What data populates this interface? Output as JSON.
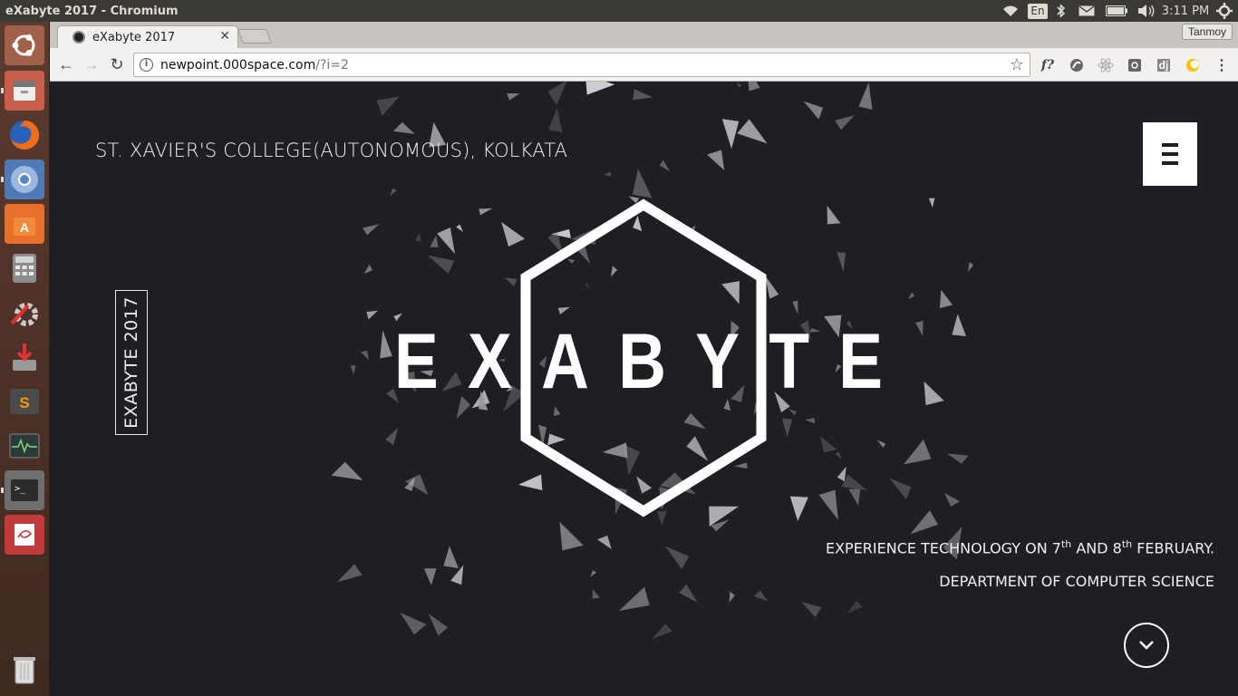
{
  "panel": {
    "window_title": "eXabyte 2017 - Chromium",
    "keyboard_layout": "En",
    "clock": "3:11 PM",
    "icons": [
      "wifi-icon",
      "bluetooth-icon",
      "mail-icon",
      "battery-icon",
      "volume-icon",
      "power-gear-icon"
    ]
  },
  "launcher": {
    "items": [
      "ubuntu-dash",
      "files",
      "firefox",
      "chromium",
      "software-center",
      "calculator",
      "system-settings",
      "installer",
      "sublime-text",
      "system-monitor",
      "terminal",
      "document-viewer",
      "trash"
    ]
  },
  "browser": {
    "tab_title": "eXabyte 2017",
    "profile_name": "Tanmoy",
    "url_host": "newpoint.000space.com",
    "url_path": "/?i=2",
    "ext_f_label": "f?",
    "ext_dj_label": "dj"
  },
  "page": {
    "college": "ST. XAVIER'S COLLEGE(AUTONOMOUS), KOLKATA",
    "side_label": "EXABYTE 2017",
    "brand": "EXABYTE",
    "info_pre": "EXPERIENCE TECHNOLOGY ON 7",
    "info_sup1": "th",
    "info_mid": " AND 8",
    "info_sup2": "th",
    "info_post": " FEBRUARY.",
    "department": "DEPARTMENT OF COMPUTER SCIENCE"
  },
  "colors": {
    "page_bg": "#1f1e25",
    "accent": "#ffffff",
    "panel_bg": "#3a3935"
  }
}
